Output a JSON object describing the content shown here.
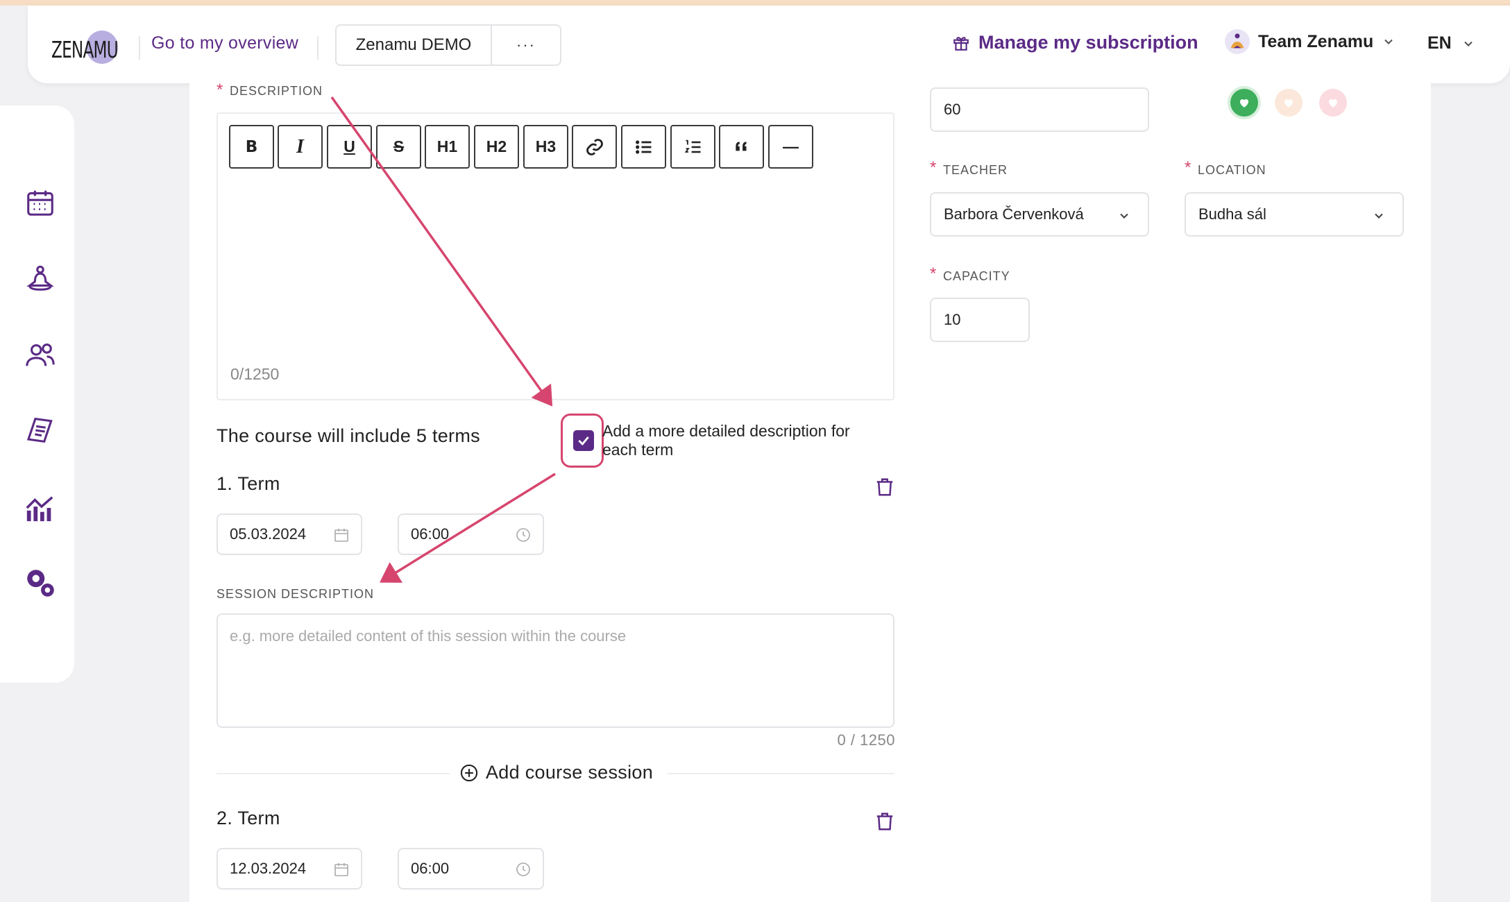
{
  "header": {
    "logo_text": "ZENAMU",
    "overview_link": "Go to my overview",
    "org_name": "Zenamu DEMO",
    "org_more": "···",
    "subscription": "Manage my subscription",
    "team": "Team Zenamu",
    "language": "EN"
  },
  "sidebar": {
    "items": [
      "calendar-icon",
      "meditation-icon",
      "users-icon",
      "document-icon",
      "statistics-icon",
      "settings-icon"
    ]
  },
  "form": {
    "description_label": "DESCRIPTION",
    "toolbar": [
      "B",
      "I",
      "U",
      "S",
      "H1",
      "H2",
      "H3",
      "link",
      "bullet-list",
      "numbered-list",
      "quote",
      "—"
    ],
    "description_counter": "0/1250",
    "terms_text": "The course will include 5 terms",
    "detailed_checkbox_label": "Add a more detailed description for each term",
    "detailed_checked": true,
    "terms": [
      {
        "title": "1. Term",
        "date": "05.03.2024",
        "time": "06:00"
      },
      {
        "title": "2. Term",
        "date": "12.03.2024",
        "time": "06:00"
      }
    ],
    "session_label": "SESSION DESCRIPTION",
    "session_placeholder": "e.g. more detailed content of this session within the course",
    "session_counter": "0 / 1250",
    "add_session": "Add course session"
  },
  "right": {
    "duration_value": "60",
    "colors": [
      "#3cae5c",
      "#fbe8da",
      "#fbdbe0"
    ],
    "teacher_label": "TEACHER",
    "teacher_value": "Barbora Červenková",
    "location_label": "LOCATION",
    "location_value": "Budha sál",
    "capacity_label": "CAPACITY",
    "capacity_value": "10"
  },
  "colors": {
    "brand_purple": "#5b2a86",
    "accent_pink": "#d6456e"
  }
}
